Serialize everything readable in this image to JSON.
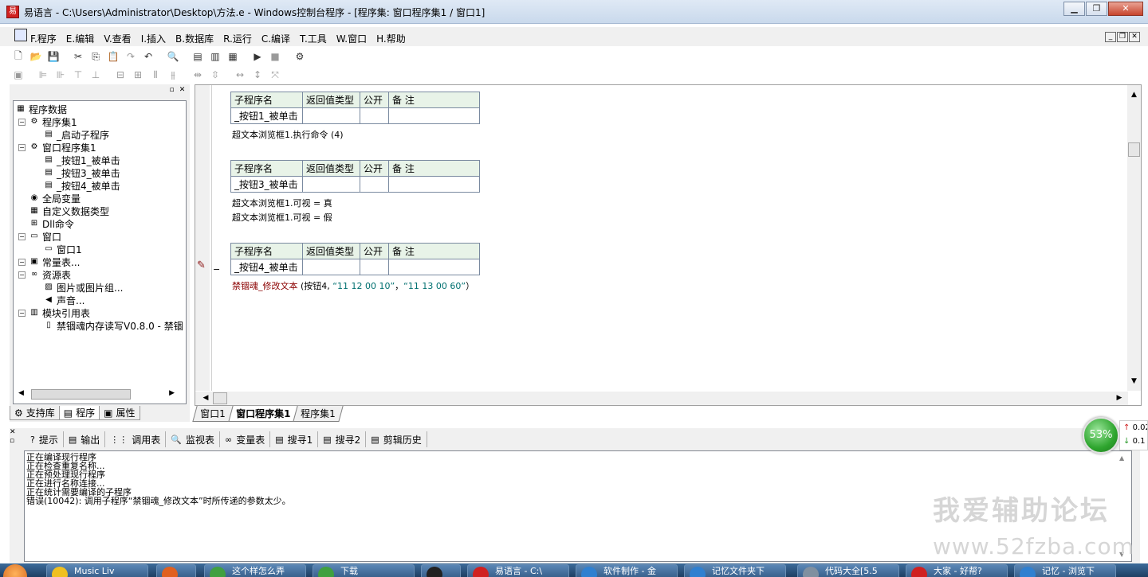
{
  "window": {
    "title": "易语言 - C:\\Users\\Administrator\\Desktop\\方法.e - Windows控制台程序 - [程序集: 窗口程序集1 / 窗口1]",
    "app_icon": "易"
  },
  "menu": [
    "F.程序",
    "E.编辑",
    "V.查看",
    "I.插入",
    "B.数据库",
    "R.运行",
    "C.编译",
    "T.工具",
    "W.窗口",
    "H.帮助"
  ],
  "toolbar1": {
    "icons": [
      "new-file-icon",
      "open-folder-icon",
      "save-icon",
      "cut-icon",
      "copy-icon",
      "paste-icon",
      "redo-icon",
      "undo-icon",
      "find-icon",
      "layout1-icon",
      "layout2-icon",
      "layout3-icon",
      "run-icon",
      "stop-icon",
      "compile-icon"
    ],
    "glyphs": [
      "🗋",
      "📂",
      "💾",
      "✂",
      "⎘",
      "📋",
      "↷",
      "↶",
      "🔍",
      "▤",
      "▥",
      "▦",
      "▶",
      "■",
      "⚙"
    ]
  },
  "toolbar2": {
    "icons": [
      "align-icon",
      "align-left-icon",
      "align-right-icon",
      "align-top-icon",
      "align-bottom-icon",
      "center-h-icon",
      "center-v-icon",
      "distribute-h-icon",
      "distribute-v-icon",
      "space-h-icon",
      "space-v-icon",
      "size-w-icon",
      "size-h-icon",
      "size-both-icon"
    ],
    "glyphs": [
      "▣",
      "⊫",
      "⊪",
      "⊤",
      "⊥",
      "⊟",
      "⊞",
      "⫴",
      "⫵",
      "⇹",
      "⇳",
      "↔",
      "↕",
      "⤧"
    ]
  },
  "tree": {
    "root": "程序数据",
    "items": [
      {
        "label": "程序集1",
        "icon": "⚙"
      },
      {
        "label": "_启动子程序",
        "icon": "▤"
      },
      {
        "label": "窗口程序集1",
        "icon": "⚙"
      },
      {
        "label": "_按钮1_被单击",
        "icon": "▤"
      },
      {
        "label": "_按钮3_被单击",
        "icon": "▤"
      },
      {
        "label": "_按钮4_被单击",
        "icon": "▤"
      },
      {
        "label": "全局变量",
        "icon": "◉"
      },
      {
        "label": "自定义数据类型",
        "icon": "▦"
      },
      {
        "label": "Dll命令",
        "icon": "⊞"
      },
      {
        "label": "窗口",
        "icon": "▭"
      },
      {
        "label": "窗口1",
        "icon": "▭"
      },
      {
        "label": "常量表...",
        "icon": "▣"
      },
      {
        "label": "资源表",
        "icon": "∞"
      },
      {
        "label": "图片或图片组...",
        "icon": "▨"
      },
      {
        "label": "声音...",
        "icon": "◀"
      },
      {
        "label": "模块引用表",
        "icon": "▥"
      },
      {
        "label": "禁锢魂内存读写V0.8.0 - 禁锢",
        "icon": "▯"
      }
    ],
    "expand_minus": "−"
  },
  "left_tabs": [
    "支持库",
    "程序",
    "属性"
  ],
  "sub_header": [
    "子程序名",
    "返回值类型",
    "公开",
    "备 注"
  ],
  "subs": [
    {
      "name": "_按钮1_被单击",
      "code": [
        "超文本浏览框1.执行命令 (4)"
      ]
    },
    {
      "name": "_按钮3_被单击",
      "code": [
        "超文本浏览框1.可视 = 真",
        "超文本浏览框1.可视 = 假"
      ]
    },
    {
      "name": "_按钮4_被单击",
      "code_call": "禁锢魂_修改文本",
      "code_args_pre": " (按钮4, ",
      "code_str1": "“11 12 00 10”",
      "code_sep": "，",
      "code_str2": "“11 13 00 60”",
      "code_end": "）"
    }
  ],
  "editor_marker": "−",
  "doc_tabs": [
    "窗口1",
    "窗口程序集1",
    "程序集1"
  ],
  "output_tabs": [
    {
      "label": "提示",
      "icon": "?"
    },
    {
      "label": "输出",
      "icon": "▤"
    },
    {
      "label": "调用表",
      "icon": "⋮⋮"
    },
    {
      "label": "监视表",
      "icon": "🔍"
    },
    {
      "label": "变量表",
      "icon": "∞"
    },
    {
      "label": "搜寻1",
      "icon": "▤"
    },
    {
      "label": "搜寻2",
      "icon": "▤"
    },
    {
      "label": "剪辑历史",
      "icon": "▤"
    }
  ],
  "output_lines": [
    "正在编译现行程序",
    "正在检查重复名称...",
    "正在预处理现行程序",
    "正在进行名称连接...",
    "正在统计需要编译的子程序",
    "错误(10042): 调用子程序“禁锢魂_修改文本”时所传递的参数太少。"
  ],
  "cpu_widget": {
    "percent": "53%",
    "up": "0.02",
    "down": "0.1"
  },
  "watermark": {
    "line1": "我爱辅助论坛",
    "line2": "www.52fzba.com"
  },
  "taskbar": [
    {
      "label": "Music Liv",
      "color": "#f0c020"
    },
    {
      "label": "",
      "color": "#e06020"
    },
    {
      "label": "这个样怎么弄",
      "color": "#40a040"
    },
    {
      "label": "下载",
      "color": "#40a040"
    },
    {
      "label": "",
      "color": "#222222"
    },
    {
      "label": "易语言 - C:\\",
      "color": "#d02020"
    },
    {
      "label": "软件制作 - 金",
      "color": "#3080d0"
    },
    {
      "label": "记忆文件夹下",
      "color": "#3080d0"
    },
    {
      "label": "代码大全[5.5",
      "color": "#8090a0"
    },
    {
      "label": "大家 - 好帮?",
      "color": "#d02020"
    },
    {
      "label": "记忆 - 浏览下",
      "color": "#3080d0"
    }
  ],
  "colors": {
    "keyword_red": "#8b0000",
    "string_teal": "#007070",
    "table_head": "#e8f3e8"
  }
}
